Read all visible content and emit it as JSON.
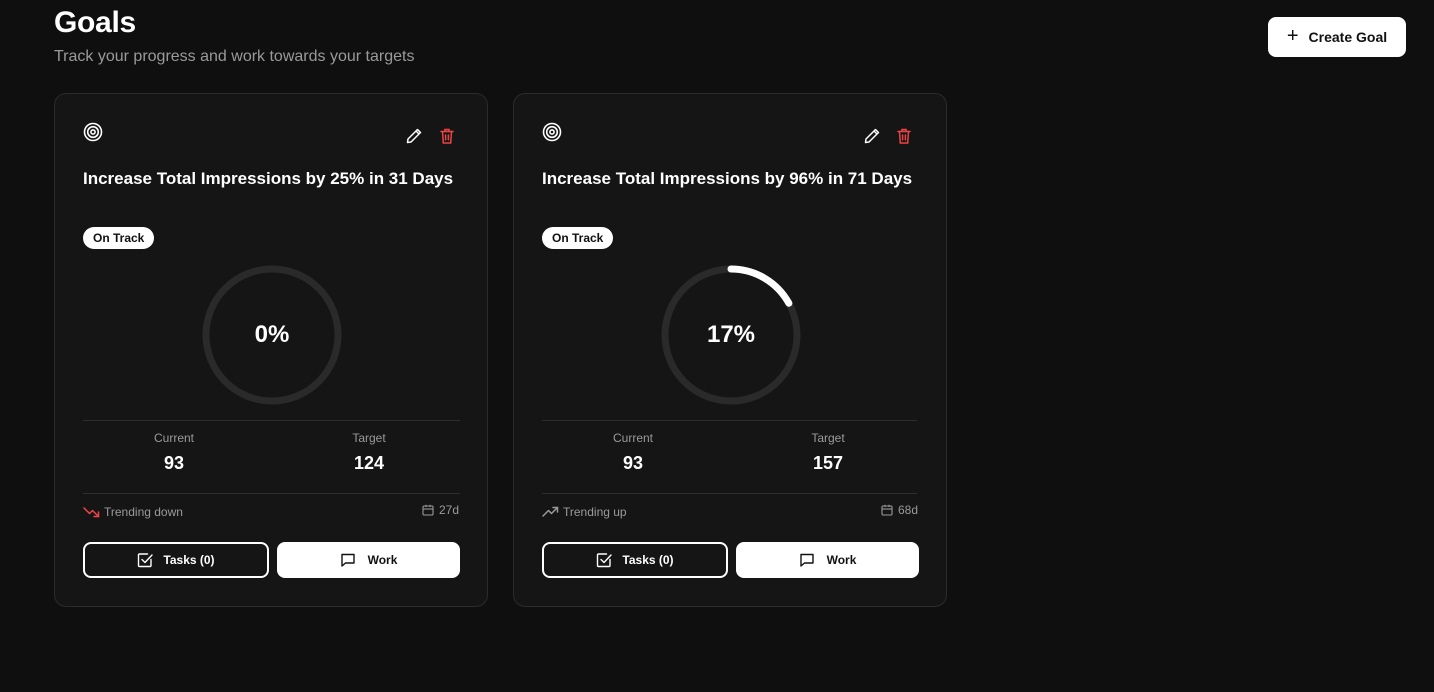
{
  "header": {
    "title": "Goals",
    "subtitle": "Track your progress and work towards your targets",
    "create_button_label": "Create Goal"
  },
  "goals": [
    {
      "title": "Increase Total Impressions by 25% in 31 Days",
      "status": "On Track",
      "progress_percent": 0,
      "progress_label": "0%",
      "current_label": "Current",
      "current_value": "93",
      "target_label": "Target",
      "target_value": "124",
      "trend_text": "Trending down",
      "trend_direction": "down",
      "trend_color": "#ef4444",
      "days_left": "27d",
      "tasks_label": "Tasks (0)",
      "work_label": "Work"
    },
    {
      "title": "Increase Total Impressions by 96% in 71 Days",
      "status": "On Track",
      "progress_percent": 17,
      "progress_label": "17%",
      "current_label": "Current",
      "current_value": "93",
      "target_label": "Target",
      "target_value": "157",
      "trend_text": "Trending up",
      "trend_direction": "up",
      "trend_color": "#9a9a9a",
      "days_left": "68d",
      "tasks_label": "Tasks (0)",
      "work_label": "Work"
    }
  ],
  "colors": {
    "background": "#0f0f0f",
    "card": "#151515",
    "accent": "#ffffff",
    "danger": "#ef4444",
    "muted": "#9a9a9a",
    "gauge_track": "#2a2a2a"
  }
}
